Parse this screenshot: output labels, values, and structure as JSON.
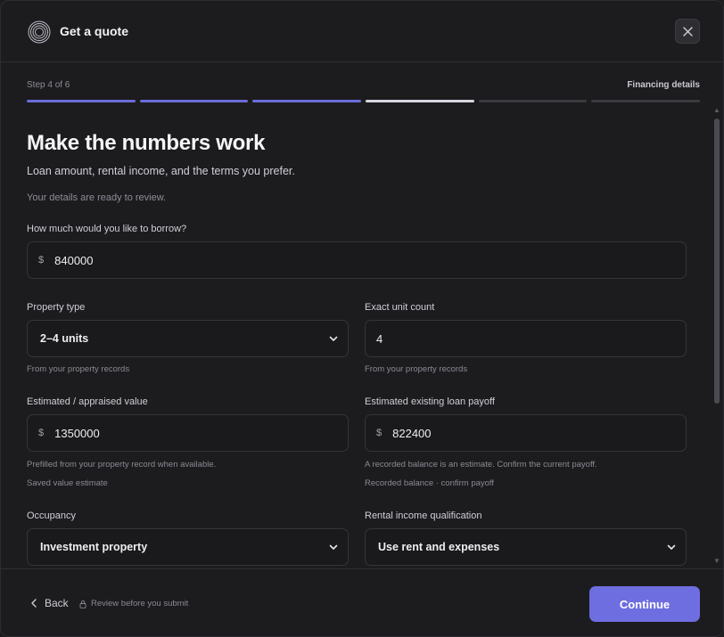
{
  "header": {
    "logo_icon": "concentric-circles-logo",
    "title": "Get a quote",
    "close_icon": "close-icon"
  },
  "progress": {
    "step_label": "Step 4 of 6",
    "step_name": "Financing details",
    "total_steps": 6,
    "current_step": 4
  },
  "intro": {
    "heading": "Make the numbers work",
    "subtitle": "Loan amount, rental income, and the terms you prefer.",
    "status": "Your details are ready to review."
  },
  "form": {
    "borrow": {
      "label": "How much would you like to borrow?",
      "prefix": "$",
      "value": "840000"
    },
    "property_type": {
      "label": "Property type",
      "value": "2–4 units",
      "hint": "From your property records"
    },
    "unit_count": {
      "label": "Exact unit count",
      "value": "4",
      "hint": "From your property records"
    },
    "appraised_value": {
      "label": "Estimated / appraised value",
      "prefix": "$",
      "value": "1350000",
      "hint": "Prefilled from your property record when available.",
      "hint2": "Saved value estimate"
    },
    "loan_payoff": {
      "label": "Estimated existing loan payoff",
      "prefix": "$",
      "value": "822400",
      "hint": "A recorded balance is an estimate. Confirm the current payoff.",
      "hint2": "Recorded balance · confirm payoff"
    },
    "occupancy": {
      "label": "Occupancy",
      "value": "Investment property"
    },
    "rental_income": {
      "label": "Rental income qualification",
      "value": "Use rent and expenses"
    }
  },
  "footer": {
    "back_label": "Back",
    "review_note": "Review before you submit",
    "continue_label": "Continue"
  },
  "colors": {
    "accent": "#6e6ee0",
    "progress_done": "#6b6cd8",
    "background": "#1c1c1f"
  }
}
